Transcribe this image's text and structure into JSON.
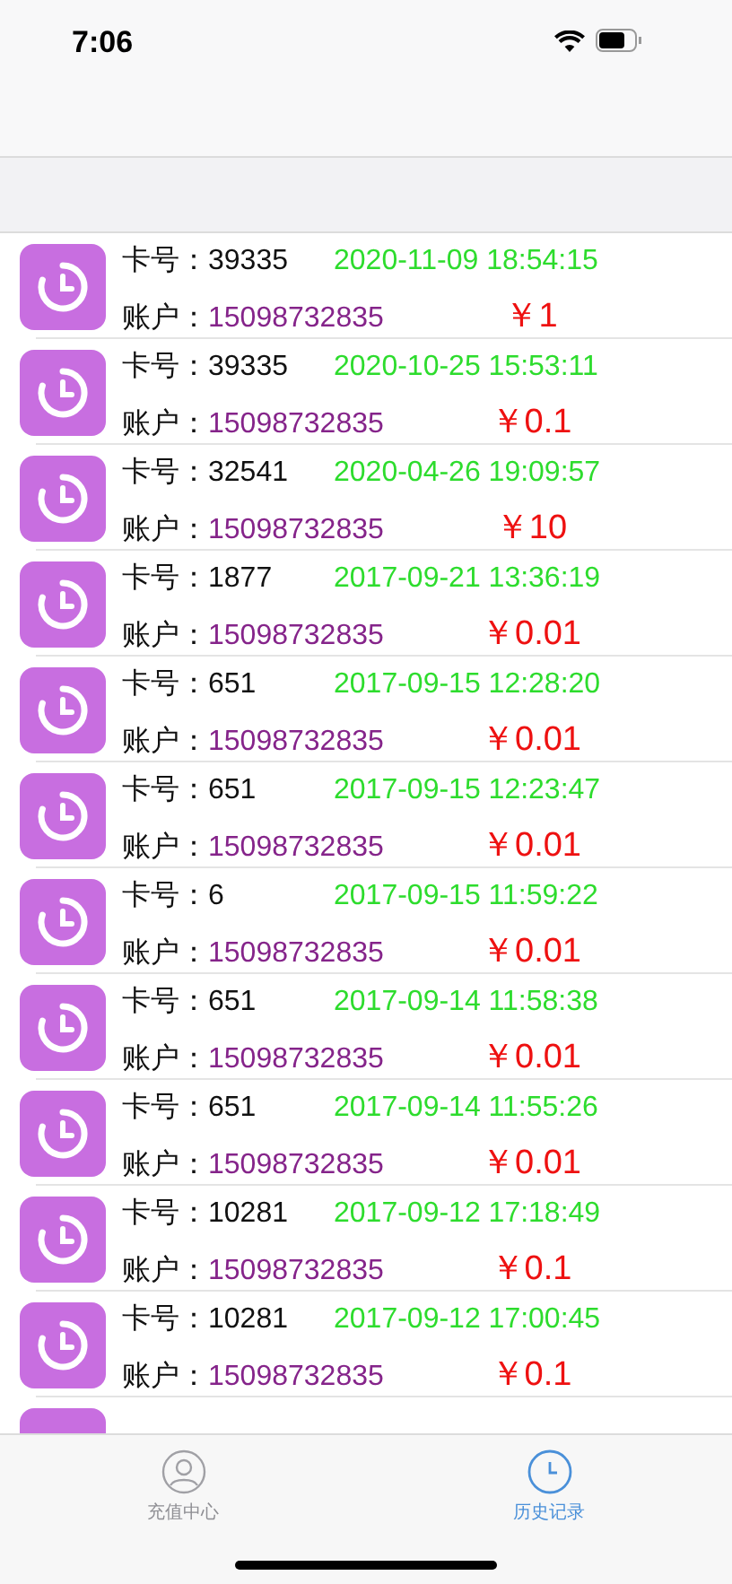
{
  "status_bar": {
    "time": "7:06"
  },
  "records": [
    {
      "card_label": "卡号：",
      "card": "39335",
      "time": "2020-11-09 18:54:15",
      "account_label": "账户：",
      "account": "15098732835",
      "amount": "￥1"
    },
    {
      "card_label": "卡号：",
      "card": "39335",
      "time": "2020-10-25 15:53:11",
      "account_label": "账户：",
      "account": "15098732835",
      "amount": "￥0.1"
    },
    {
      "card_label": "卡号：",
      "card": "32541",
      "time": "2020-04-26 19:09:57",
      "account_label": "账户：",
      "account": "15098732835",
      "amount": "￥10"
    },
    {
      "card_label": "卡号：",
      "card": "1877",
      "time": "2017-09-21 13:36:19",
      "account_label": "账户：",
      "account": "15098732835",
      "amount": "￥0.01"
    },
    {
      "card_label": "卡号：",
      "card": "651",
      "time": "2017-09-15 12:28:20",
      "account_label": "账户：",
      "account": "15098732835",
      "amount": "￥0.01"
    },
    {
      "card_label": "卡号：",
      "card": "651",
      "time": "2017-09-15 12:23:47",
      "account_label": "账户：",
      "account": "15098732835",
      "amount": "￥0.01"
    },
    {
      "card_label": "卡号：",
      "card": "6",
      "time": "2017-09-15 11:59:22",
      "account_label": "账户：",
      "account": "15098732835",
      "amount": "￥0.01"
    },
    {
      "card_label": "卡号：",
      "card": "651",
      "time": "2017-09-14 11:58:38",
      "account_label": "账户：",
      "account": "15098732835",
      "amount": "￥0.01"
    },
    {
      "card_label": "卡号：",
      "card": "651",
      "time": "2017-09-14 11:55:26",
      "account_label": "账户：",
      "account": "15098732835",
      "amount": "￥0.01"
    },
    {
      "card_label": "卡号：",
      "card": "10281",
      "time": "2017-09-12 17:18:49",
      "account_label": "账户：",
      "account": "15098732835",
      "amount": "￥0.1"
    },
    {
      "card_label": "卡号：",
      "card": "10281",
      "time": "2017-09-12 17:00:45",
      "account_label": "账户：",
      "account": "15098732835",
      "amount": "￥0.1"
    }
  ],
  "tab_bar": [
    {
      "kind": "person",
      "label": "充值中心",
      "selected": false
    },
    {
      "kind": "clock",
      "label": "历史记录",
      "selected": true
    }
  ]
}
